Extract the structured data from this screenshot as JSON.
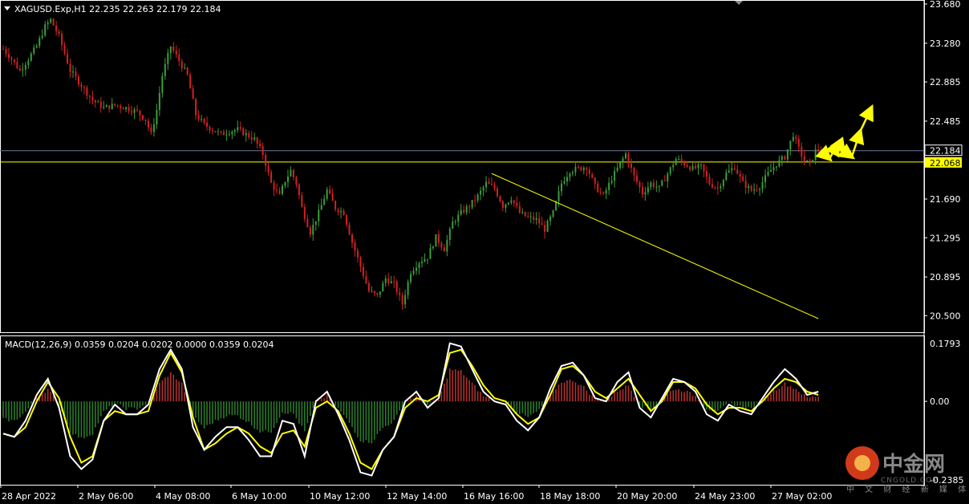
{
  "header": {
    "symbol_line": "XAGUSD.Exp,H1  22.235 22.263 22.179 22.184",
    "macd_line": "MACD(12,26,9) 0.0359 0.0204 0.0202 0.0000 0.0359 0.0204"
  },
  "price_axis": {
    "ticks": [
      "23.680",
      "23.280",
      "22.885",
      "22.485",
      "21.690",
      "21.295",
      "20.895",
      "20.500"
    ],
    "current_price_label": "22.184",
    "level_label": "22.068"
  },
  "macd_axis": {
    "ticks": [
      "0.1793",
      "0.00",
      "-0.2385"
    ]
  },
  "time_axis": {
    "labels": [
      "28 Apr 2022",
      "2 May 06:00",
      "4 May 08:00",
      "6 May 10:00",
      "10 May 12:00",
      "12 May 14:00",
      "16 May 16:00",
      "18 May 18:00",
      "20 May 20:00",
      "24 May 23:00",
      "27 May 02:00"
    ]
  },
  "watermark": {
    "main": "中金网",
    "url": "CNGOLD.COM",
    "sub": "中 文 财 经 新 媒 体"
  },
  "colors": {
    "background": "#000000",
    "bull": "#3a9e3a",
    "bear": "#d22222",
    "level_line": "#ffff00",
    "current_price_line": "#6c7a99",
    "macd_line": "#ffffff",
    "signal_line": "#ffff00",
    "hist_positive": "#b03030",
    "hist_negative": "#2a7a2a",
    "forecast_arrows": "#ffff00"
  },
  "chart_data": {
    "type": "candlestick",
    "symbol": "XAGUSD.Exp",
    "timeframe": "H1",
    "last_ohlc": {
      "open": 22.235,
      "high": 22.263,
      "low": 22.179,
      "close": 22.184
    },
    "ylim": [
      20.47,
      23.68
    ],
    "current_price": 22.184,
    "horizontal_level": 22.068,
    "price_path": [
      [
        0,
        23.22
      ],
      [
        3,
        23.12
      ],
      [
        6,
        23.0
      ],
      [
        9,
        23.12
      ],
      [
        12,
        23.25
      ],
      [
        15,
        23.45
      ],
      [
        17,
        23.52
      ],
      [
        20,
        23.35
      ],
      [
        24,
        23.0
      ],
      [
        28,
        22.85
      ],
      [
        32,
        22.7
      ],
      [
        36,
        22.62
      ],
      [
        40,
        22.65
      ],
      [
        44,
        22.62
      ],
      [
        48,
        22.58
      ],
      [
        51,
        22.5
      ],
      [
        53,
        22.35
      ],
      [
        55,
        22.6
      ],
      [
        57,
        22.95
      ],
      [
        60,
        23.25
      ],
      [
        63,
        23.1
      ],
      [
        66,
        22.95
      ],
      [
        69,
        22.55
      ],
      [
        72,
        22.45
      ],
      [
        75,
        22.4
      ],
      [
        78,
        22.35
      ],
      [
        81,
        22.38
      ],
      [
        84,
        22.4
      ],
      [
        87,
        22.35
      ],
      [
        90,
        22.3
      ],
      [
        93,
        22.15
      ],
      [
        96,
        21.85
      ],
      [
        99,
        21.72
      ],
      [
        101,
        21.88
      ],
      [
        103,
        21.98
      ],
      [
        105,
        21.85
      ],
      [
        107,
        21.6
      ],
      [
        110,
        21.35
      ],
      [
        113,
        21.55
      ],
      [
        116,
        21.78
      ],
      [
        119,
        21.6
      ],
      [
        122,
        21.55
      ],
      [
        125,
        21.25
      ],
      [
        128,
        21.0
      ],
      [
        131,
        20.75
      ],
      [
        134,
        20.7
      ],
      [
        137,
        20.88
      ],
      [
        140,
        20.82
      ],
      [
        143,
        20.62
      ],
      [
        146,
        20.95
      ],
      [
        149,
        21.05
      ],
      [
        152,
        21.1
      ],
      [
        155,
        21.3
      ],
      [
        158,
        21.18
      ],
      [
        161,
        21.45
      ],
      [
        164,
        21.55
      ],
      [
        167,
        21.62
      ],
      [
        170,
        21.72
      ],
      [
        173,
        21.85
      ],
      [
        176,
        21.8
      ],
      [
        179,
        21.62
      ],
      [
        182,
        21.7
      ],
      [
        185,
        21.55
      ],
      [
        188,
        21.5
      ],
      [
        191,
        21.48
      ],
      [
        194,
        21.38
      ],
      [
        197,
        21.55
      ],
      [
        200,
        21.85
      ],
      [
        203,
        21.98
      ],
      [
        206,
        22.0
      ],
      [
        209,
        22.02
      ],
      [
        212,
        21.82
      ],
      [
        215,
        21.72
      ],
      [
        218,
        21.9
      ],
      [
        221,
        22.05
      ],
      [
        223,
        22.15
      ],
      [
        226,
        21.92
      ],
      [
        229,
        21.75
      ],
      [
        232,
        21.85
      ],
      [
        235,
        21.8
      ],
      [
        238,
        21.95
      ],
      [
        241,
        22.1
      ],
      [
        244,
        22.05
      ],
      [
        247,
        22.0
      ],
      [
        250,
        22.02
      ],
      [
        253,
        21.85
      ],
      [
        256,
        21.8
      ],
      [
        259,
        21.95
      ],
      [
        262,
        22.02
      ],
      [
        265,
        21.85
      ],
      [
        268,
        21.78
      ],
      [
        271,
        21.82
      ],
      [
        274,
        21.95
      ],
      [
        277,
        22.05
      ],
      [
        280,
        22.12
      ],
      [
        283,
        22.35
      ],
      [
        285,
        22.2
      ],
      [
        287,
        22.08
      ],
      [
        289,
        22.05
      ],
      [
        291,
        22.18
      ],
      [
        293,
        22.18
      ]
    ],
    "trendline": {
      "from": [
        175,
        21.95
      ],
      "to": [
        292,
        20.47
      ]
    },
    "forecast_arrows": [
      [
        293,
        22.18
      ],
      [
        296,
        22.1
      ],
      [
        299,
        22.26
      ],
      [
        301,
        22.18
      ],
      [
        304,
        22.12
      ],
      [
        307,
        22.38
      ],
      [
        311,
        22.62
      ]
    ],
    "macd": {
      "ylim": [
        -0.2385,
        0.1793
      ],
      "zero": 0,
      "macd_path": [
        [
          0,
          -0.1
        ],
        [
          4,
          -0.11
        ],
        [
          8,
          -0.06
        ],
        [
          12,
          0.02
        ],
        [
          16,
          0.07
        ],
        [
          20,
          -0.02
        ],
        [
          24,
          -0.17
        ],
        [
          28,
          -0.21
        ],
        [
          32,
          -0.18
        ],
        [
          36,
          -0.06
        ],
        [
          40,
          -0.01
        ],
        [
          44,
          -0.04
        ],
        [
          48,
          -0.04
        ],
        [
          52,
          -0.01
        ],
        [
          56,
          0.1
        ],
        [
          60,
          0.16
        ],
        [
          64,
          0.1
        ],
        [
          68,
          -0.08
        ],
        [
          72,
          -0.15
        ],
        [
          76,
          -0.11
        ],
        [
          80,
          -0.08
        ],
        [
          84,
          -0.08
        ],
        [
          88,
          -0.12
        ],
        [
          92,
          -0.17
        ],
        [
          96,
          -0.17
        ],
        [
          100,
          -0.06
        ],
        [
          104,
          -0.07
        ],
        [
          108,
          -0.17
        ],
        [
          112,
          0.0
        ],
        [
          116,
          0.03
        ],
        [
          120,
          -0.04
        ],
        [
          124,
          -0.12
        ],
        [
          128,
          -0.22
        ],
        [
          132,
          -0.23
        ],
        [
          136,
          -0.15
        ],
        [
          140,
          -0.11
        ],
        [
          144,
          0.0
        ],
        [
          148,
          0.03
        ],
        [
          152,
          -0.02
        ],
        [
          156,
          0.01
        ],
        [
          160,
          0.18
        ],
        [
          164,
          0.17
        ],
        [
          168,
          0.1
        ],
        [
          172,
          0.03
        ],
        [
          176,
          0.0
        ],
        [
          180,
          -0.01
        ],
        [
          184,
          -0.06
        ],
        [
          188,
          -0.09
        ],
        [
          192,
          -0.05
        ],
        [
          196,
          0.04
        ],
        [
          200,
          0.11
        ],
        [
          204,
          0.12
        ],
        [
          208,
          0.08
        ],
        [
          212,
          0.01
        ],
        [
          216,
          0.0
        ],
        [
          220,
          0.06
        ],
        [
          224,
          0.09
        ],
        [
          228,
          -0.02
        ],
        [
          232,
          -0.05
        ],
        [
          236,
          0.01
        ],
        [
          240,
          0.07
        ],
        [
          244,
          0.06
        ],
        [
          248,
          0.03
        ],
        [
          252,
          -0.04
        ],
        [
          256,
          -0.06
        ],
        [
          260,
          -0.01
        ],
        [
          264,
          -0.03
        ],
        [
          268,
          -0.04
        ],
        [
          272,
          0.01
        ],
        [
          276,
          0.06
        ],
        [
          280,
          0.1
        ],
        [
          284,
          0.07
        ],
        [
          288,
          0.02
        ],
        [
          292,
          0.03
        ]
      ],
      "signal_path": [
        [
          0,
          -0.1
        ],
        [
          4,
          -0.11
        ],
        [
          8,
          -0.08
        ],
        [
          12,
          0.0
        ],
        [
          16,
          0.06
        ],
        [
          20,
          0.01
        ],
        [
          24,
          -0.11
        ],
        [
          28,
          -0.19
        ],
        [
          32,
          -0.17
        ],
        [
          36,
          -0.06
        ],
        [
          40,
          -0.03
        ],
        [
          44,
          -0.04
        ],
        [
          48,
          -0.04
        ],
        [
          52,
          -0.03
        ],
        [
          56,
          0.08
        ],
        [
          60,
          0.15
        ],
        [
          64,
          0.09
        ],
        [
          68,
          -0.05
        ],
        [
          72,
          -0.15
        ],
        [
          76,
          -0.13
        ],
        [
          80,
          -0.1
        ],
        [
          84,
          -0.08
        ],
        [
          88,
          -0.1
        ],
        [
          92,
          -0.14
        ],
        [
          96,
          -0.16
        ],
        [
          100,
          -0.1
        ],
        [
          104,
          -0.09
        ],
        [
          108,
          -0.14
        ],
        [
          112,
          -0.02
        ],
        [
          116,
          0.0
        ],
        [
          120,
          -0.03
        ],
        [
          124,
          -0.1
        ],
        [
          128,
          -0.19
        ],
        [
          132,
          -0.21
        ],
        [
          136,
          -0.15
        ],
        [
          140,
          -0.11
        ],
        [
          144,
          -0.02
        ],
        [
          148,
          0.01
        ],
        [
          152,
          0.0
        ],
        [
          156,
          0.02
        ],
        [
          160,
          0.15
        ],
        [
          164,
          0.16
        ],
        [
          168,
          0.11
        ],
        [
          172,
          0.05
        ],
        [
          176,
          0.01
        ],
        [
          180,
          0.0
        ],
        [
          184,
          -0.04
        ],
        [
          188,
          -0.07
        ],
        [
          192,
          -0.05
        ],
        [
          196,
          0.02
        ],
        [
          200,
          0.1
        ],
        [
          204,
          0.11
        ],
        [
          208,
          0.08
        ],
        [
          212,
          0.03
        ],
        [
          216,
          0.01
        ],
        [
          220,
          0.04
        ],
        [
          224,
          0.07
        ],
        [
          228,
          0.02
        ],
        [
          232,
          -0.03
        ],
        [
          236,
          0.0
        ],
        [
          240,
          0.06
        ],
        [
          244,
          0.06
        ],
        [
          248,
          0.04
        ],
        [
          252,
          -0.01
        ],
        [
          256,
          -0.04
        ],
        [
          260,
          -0.02
        ],
        [
          264,
          -0.02
        ],
        [
          268,
          -0.03
        ],
        [
          272,
          0.0
        ],
        [
          276,
          0.04
        ],
        [
          280,
          0.07
        ],
        [
          284,
          0.06
        ],
        [
          288,
          0.03
        ],
        [
          292,
          0.02
        ]
      ]
    }
  }
}
